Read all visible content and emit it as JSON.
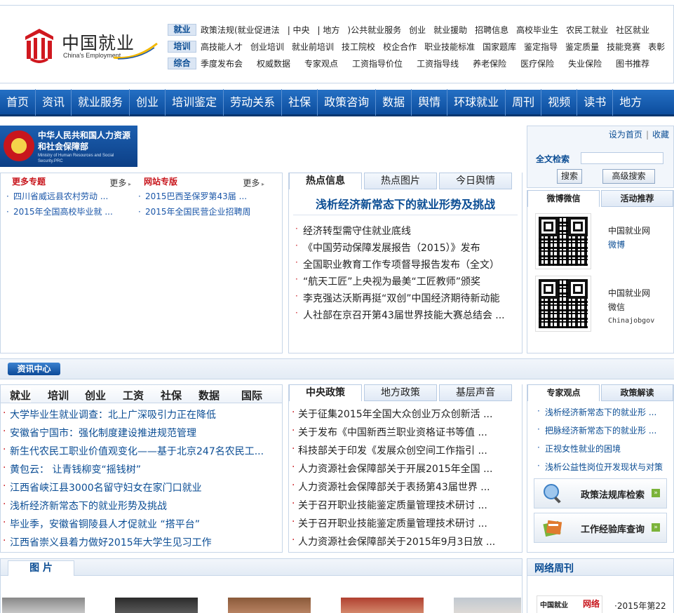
{
  "header": {
    "logo_cn": "中国就业",
    "logo_en": "China's Employment",
    "rows": [
      {
        "tag": "就业",
        "links": [
          "政策法规(就业促进法",
          "| 中央",
          "| 地方",
          ")公共就业服务",
          "创业",
          "就业援助",
          "招聘信息",
          "高校毕业生",
          "农民工就业",
          "社区就业"
        ]
      },
      {
        "tag": "培训",
        "links": [
          "高技能人才",
          "创业培训",
          "就业前培训",
          "技工院校",
          "校企合作",
          "职业技能标准",
          "国家题库",
          "鉴定指导",
          "鉴定质量",
          "技能竞赛",
          "表彰"
        ]
      },
      {
        "tag": "综合",
        "links": [
          "季度发布会",
          "权威数据",
          "专家观点",
          "工资指导价位",
          "工资指导线",
          "养老保险",
          "医疗保险",
          "失业保险",
          "图书推荐"
        ]
      }
    ]
  },
  "main_nav": [
    "首页",
    "资讯",
    "就业服务",
    "创业",
    "培训鉴定",
    "劳动关系",
    "社保",
    "政策咨询",
    "数据",
    "舆情",
    "环球就业",
    "周刊",
    "视频",
    "读书",
    "地方"
  ],
  "ministry": {
    "name_cn": "中华人民共和国人力资源和社会保障部",
    "name_en": "Ministry of Human Resources and Social Security.PRC"
  },
  "topics": {
    "more_label": "更多",
    "col1": {
      "title": "更多专题",
      "items": [
        "四川省威远县农村劳动 ...",
        "2015年全国高校毕业就 ..."
      ]
    },
    "col2": {
      "title": "网站专版",
      "items": [
        "2015巴西圣保罗第43届 ...",
        "2015年全国民营企业招聘周"
      ]
    }
  },
  "hot": {
    "tabs": [
      "热点信息",
      "热点图片",
      "今日舆情"
    ],
    "headline": "浅析经济新常态下的就业形势及挑战",
    "items": [
      "经济转型需守住就业底线",
      "《中国劳动保障发展报告（2015）》发布",
      "全国职业教育工作专项督导报告发布（全文）",
      "“航天工匠”上央视为最美“工匠教师”颁奖",
      "李克强达沃斯再挺“双创”中国经济期待新动能",
      "人社部在京召开第43届世界技能大赛总结会 ..."
    ]
  },
  "search": {
    "home_link": "设为首页",
    "fav_link": "收藏",
    "label": "全文检索",
    "placeholder": "",
    "search_btn": "搜索",
    "adv_btn": "高级搜索"
  },
  "weibo": {
    "tabs": [
      "微博微信",
      "活动推荐"
    ],
    "qr1_line1": "中国就业网",
    "qr1_line2": "微博",
    "qr2_line1": "中国就业网",
    "qr2_line2": "微信",
    "qr2_line3": "Chinajobgov"
  },
  "info_center": {
    "label": "资讯中心"
  },
  "jobs": {
    "tabs": [
      "就业",
      "培训",
      "创业",
      "工资",
      "社保",
      "数据",
      "国际"
    ],
    "items": [
      "大学毕业生就业调查：北上广深吸引力正在降低",
      "安徽省宁国市：强化制度建设推进规范管理",
      "新生代农民工职业价值观变化——基于北京247名农民工...",
      "黄包云： 让青钱柳变“摇钱树”",
      "江西省峡江县3000名留守妇女在家门口就业",
      "浅析经济新常态下的就业形势及挑战",
      "毕业季，安徽省铜陵县人才促就业 “搭平台”",
      "江西省崇义县着力做好2015年大学生见习工作"
    ]
  },
  "policy": {
    "tabs": [
      "中央政策",
      "地方政策",
      "基层声音"
    ],
    "items": [
      "关于征集2015年全国大众创业万众创新活 ...",
      "关于发布《中国新西兰职业资格证书等值 ...",
      "科技部关于印发《发展众创空间工作指引 ...",
      "人力资源社会保障部关于开展2015年全国 ...",
      "人力资源社会保障部关于表扬第43届世界 ...",
      "关于召开职业技能鉴定质量管理技术研讨 ...",
      "关于召开职业技能鉴定质量管理技术研讨 ...",
      "人力资源社会保障部关于2015年9月3日放 ..."
    ]
  },
  "expert": {
    "tabs": [
      "专家观点",
      "政策解读"
    ],
    "items": [
      "浅析经济新常态下的就业形 ...",
      "把脉经济新常态下的就业形 ...",
      "正视女性就业的困境",
      "浅析公益性岗位开发现状与对策"
    ],
    "db_buttons": [
      "政策法规库检索",
      "工作经验库查询"
    ]
  },
  "pictures": {
    "tab": "图 片"
  },
  "weekly": {
    "title": "网络周刊",
    "thumb_logo": "中国就业",
    "thumb_red": "网络",
    "issue": "·2015年第22"
  }
}
